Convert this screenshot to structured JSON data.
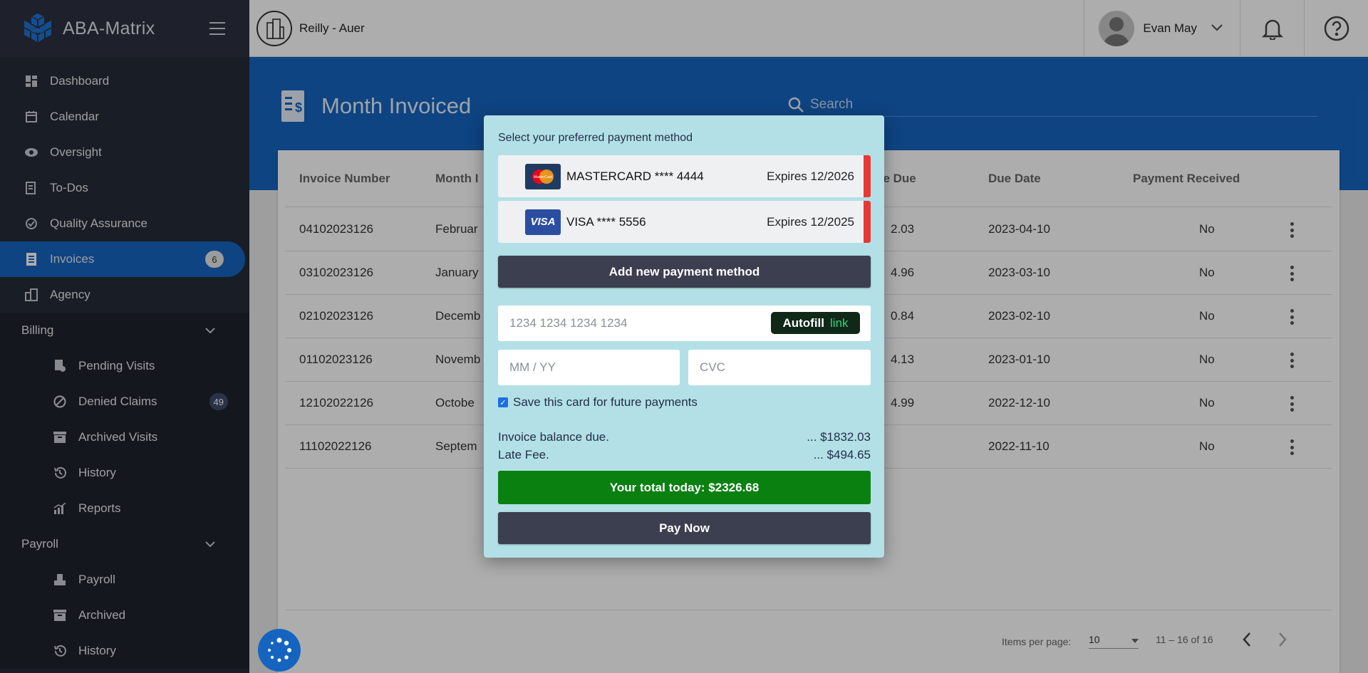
{
  "app": {
    "title": "ABA-Matrix"
  },
  "topbar": {
    "org_name": "Reilly - Auer",
    "user_name": "Evan May"
  },
  "sidebar": {
    "items": [
      {
        "label": "Dashboard"
      },
      {
        "label": "Calendar"
      },
      {
        "label": "Oversight"
      },
      {
        "label": "To-Dos"
      },
      {
        "label": "Quality Assurance"
      },
      {
        "label": "Invoices",
        "badge": "6"
      },
      {
        "label": "Agency"
      }
    ],
    "billing": {
      "label": "Billing",
      "items": [
        {
          "label": "Pending Visits"
        },
        {
          "label": "Denied Claims",
          "badge": "49"
        },
        {
          "label": "Archived Visits"
        },
        {
          "label": "History"
        },
        {
          "label": "Reports"
        }
      ]
    },
    "payroll": {
      "label": "Payroll",
      "items": [
        {
          "label": "Payroll"
        },
        {
          "label": "Archived"
        },
        {
          "label": "History"
        }
      ]
    }
  },
  "page": {
    "title": "Month Invoiced",
    "search_placeholder": "Search"
  },
  "table": {
    "headers": {
      "invoice_number": "Invoice Number",
      "month": "Month I",
      "balance_due": "ce Due",
      "due_date": "Due Date",
      "payment_received": "Payment Received"
    },
    "rows": [
      {
        "invoice": "04102023126",
        "month": "Februar",
        "due": "2.03",
        "date": "2023-04-10",
        "received": "No"
      },
      {
        "invoice": "03102023126",
        "month": "January",
        "due": "4.96",
        "date": "2023-03-10",
        "received": "No"
      },
      {
        "invoice": "02102023126",
        "month": "Decemb",
        "due": "0.84",
        "date": "2023-02-10",
        "received": "No"
      },
      {
        "invoice": "01102023126",
        "month": "Novemb",
        "due": "4.13",
        "date": "2023-01-10",
        "received": "No"
      },
      {
        "invoice": "12102022126",
        "month": "Octobe",
        "due": "4.99",
        "date": "2022-12-10",
        "received": "No"
      },
      {
        "invoice": "11102022126",
        "month": "Septem",
        "due": "",
        "date": "2022-11-10",
        "received": "No"
      }
    ]
  },
  "paginator": {
    "items_per_page_label": "Items per page:",
    "page_size": "10",
    "range": "11 – 16 of 16"
  },
  "modal": {
    "title": "Select your preferred payment method",
    "cards": [
      {
        "brand": "mastercard",
        "label": "MASTERCARD **** 4444",
        "expires": "Expires 12/2026",
        "brand_text": "MasterCard"
      },
      {
        "brand": "visa",
        "label": "VISA **** 5556",
        "expires": "Expires 12/2025",
        "brand_text": "VISA"
      }
    ],
    "add_button": "Add new payment method",
    "card_number_placeholder": "1234 1234 1234 1234",
    "autofill_label": "Autofill",
    "autofill_link": "link",
    "expiry_placeholder": "MM / YY",
    "cvc_placeholder": "CVC",
    "save_card_label": "Save this card for future payments",
    "save_card_checked": true,
    "balance_label": "Invoice balance due.",
    "balance_value": "... $1832.03",
    "late_fee_label": "Late Fee.",
    "late_fee_value": "... $494.65",
    "total_label": "Your total today: $2326.68",
    "pay_button": "Pay Now"
  },
  "colors": {
    "sidebar_bg": "#262b37",
    "accent_blue": "#1565c0",
    "modal_bg": "#b3e0e6",
    "danger": "#e53935",
    "success": "#0a8011",
    "button_dark": "#3c3f50"
  }
}
